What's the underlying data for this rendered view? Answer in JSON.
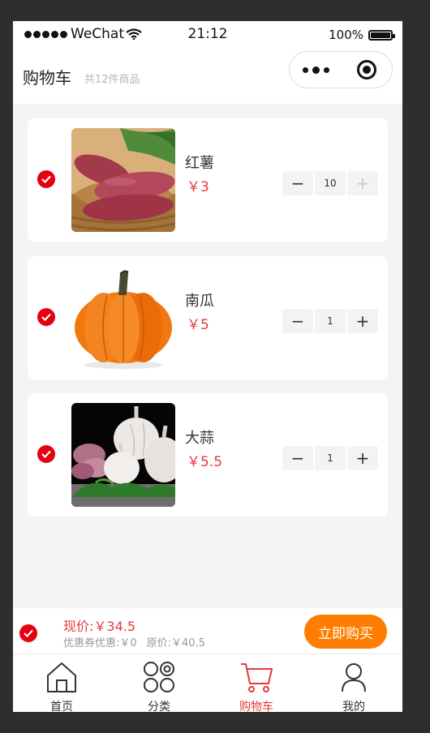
{
  "status_bar": {
    "carrier": "WeChat",
    "time": "21:12",
    "battery": "100%",
    "battery_level": 1.0
  },
  "navbar": {
    "title": "购物车",
    "count_text": "共12件商品"
  },
  "items": [
    {
      "name": "红薯",
      "price": "￥3",
      "qty": "10",
      "checked": true,
      "image": "sweet-potato"
    },
    {
      "name": "南瓜",
      "price": "￥5",
      "qty": "1",
      "checked": true,
      "image": "pumpkin"
    },
    {
      "name": "大蒜",
      "price": "￥5.5",
      "qty": "1",
      "checked": true,
      "image": "garlic"
    }
  ],
  "submit_bar": {
    "current_price": "现价:￥34.5",
    "coupon": "优惠券优惠:￥0",
    "original_price": "原价:￥40.5",
    "buy_label": "立即购买"
  },
  "tabs": [
    {
      "label": "首页",
      "icon": "home-icon",
      "active": false
    },
    {
      "label": "分类",
      "icon": "category-icon",
      "active": false
    },
    {
      "label": "购物车",
      "icon": "cart-icon",
      "active": true
    },
    {
      "label": "我的",
      "icon": "user-icon",
      "active": false
    }
  ],
  "colors": {
    "accent": "#e4393c",
    "check": "#e60012",
    "buy_button": "#ff7d00",
    "background": "#f3f4f6"
  }
}
